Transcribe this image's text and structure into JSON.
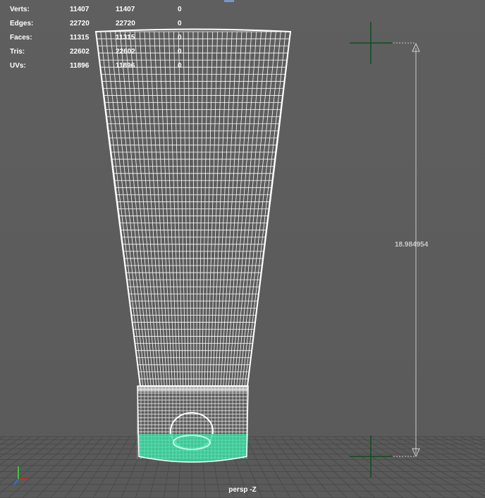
{
  "hud": {
    "rows": [
      {
        "label": "Verts:",
        "v1": "11407",
        "v2": "11407",
        "v3": "0"
      },
      {
        "label": "Edges:",
        "v1": "22720",
        "v2": "22720",
        "v3": "0"
      },
      {
        "label": "Faces:",
        "v1": "11315",
        "v2": "11315",
        "v3": "0"
      },
      {
        "label": "Tris:",
        "v1": "22602",
        "v2": "22602",
        "v3": "0"
      },
      {
        "label": "UVs:",
        "v1": "11896",
        "v2": "11896",
        "v3": "0"
      }
    ]
  },
  "measure": {
    "distance": "18.984954"
  },
  "camera": {
    "label": "persp -Z"
  },
  "colors": {
    "background": "#5e5e5e",
    "wire": "#ffffff",
    "selected_wire": "#3ad9a2",
    "grid": "#4a4a4a",
    "locator": "#0e4d1e",
    "axis_x": "#d12a2a",
    "axis_y": "#3cc43c",
    "axis_z": "#3a6ad6"
  }
}
